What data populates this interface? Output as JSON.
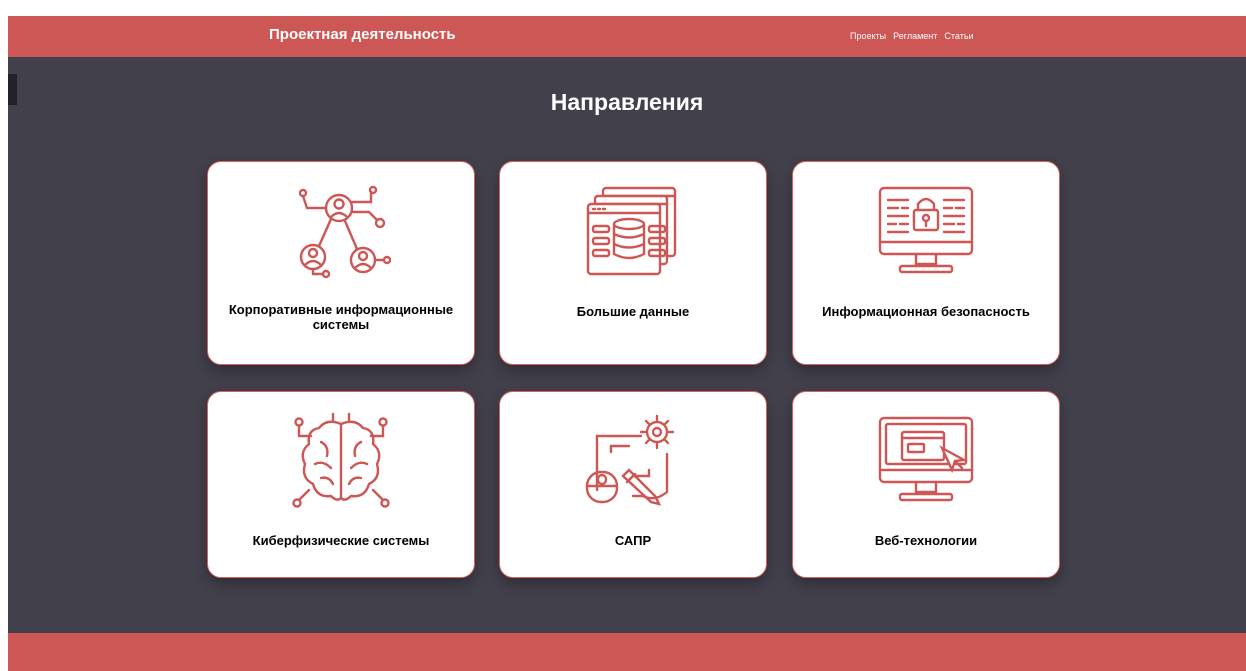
{
  "header": {
    "brand": "Проектная деятельность",
    "nav": [
      "Проекты",
      "Регламент",
      "Статьи"
    ]
  },
  "main": {
    "title": "Направления",
    "cards": [
      {
        "label": "Корпоративные информационные системы",
        "icon": "network-people-icon"
      },
      {
        "label": "Большие данные",
        "icon": "database-windows-icon"
      },
      {
        "label": "Информационная безопасность",
        "icon": "monitor-lock-icon"
      },
      {
        "label": "Киберфизические системы",
        "icon": "circuit-brain-icon"
      },
      {
        "label": "САПР",
        "icon": "cad-gear-mouse-icon"
      },
      {
        "label": "Веб-технологии",
        "icon": "monitor-cursor-icon"
      }
    ]
  },
  "colors": {
    "accent": "#cd5755",
    "background": "#42404b",
    "card": "#ffffff"
  }
}
